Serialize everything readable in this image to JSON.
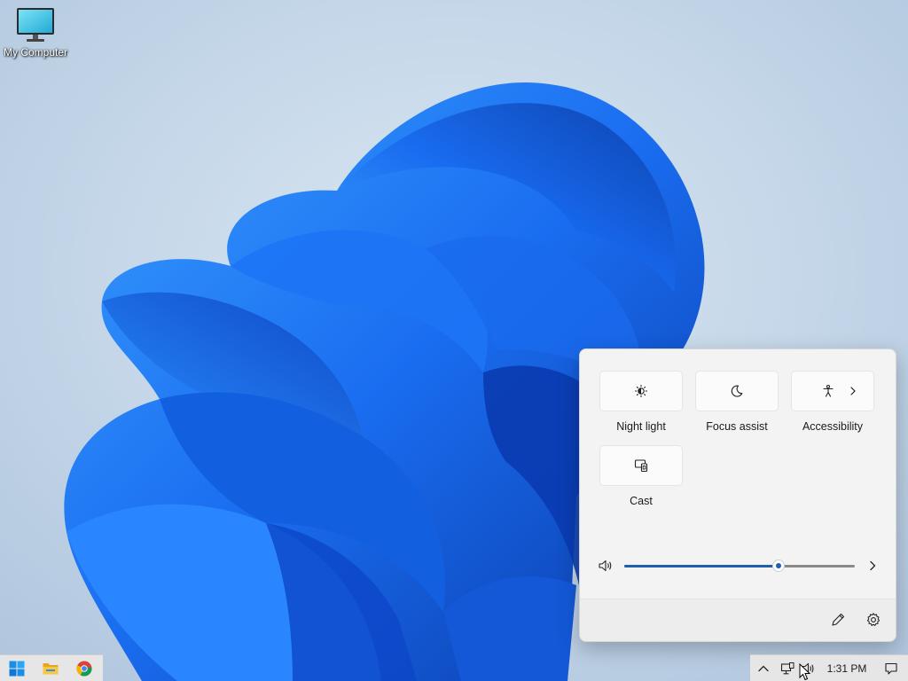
{
  "desktop": {
    "icons": [
      {
        "label": "My Computer",
        "icon": "computer-monitor-icon"
      }
    ]
  },
  "quick_settings": {
    "tiles": [
      {
        "label": "Night light",
        "icon": "night-light-icon",
        "has_chevron": false
      },
      {
        "label": "Focus assist",
        "icon": "moon-icon",
        "has_chevron": false
      },
      {
        "label": "Accessibility",
        "icon": "accessibility-icon",
        "has_chevron": true
      },
      {
        "label": "Cast",
        "icon": "cast-icon",
        "has_chevron": false
      }
    ],
    "volume": {
      "level": 0.67,
      "icon": "speaker-icon"
    },
    "footer": {
      "edit_icon": "pencil-icon",
      "settings_icon": "gear-icon"
    }
  },
  "taskbar": {
    "pinned": [
      {
        "name": "start",
        "icon": "windows-logo-icon"
      },
      {
        "name": "file-explorer",
        "icon": "folder-icon"
      },
      {
        "name": "chrome",
        "icon": "chrome-icon"
      }
    ],
    "tray": {
      "icons": [
        "chevron-up-icon",
        "network-icon",
        "volume-icon"
      ],
      "clock": "1:31 PM",
      "notification_icon": "notification-icon"
    }
  },
  "colors": {
    "accent": "#1f5fae",
    "wallpaper_bg": "#c4d6e8",
    "bloom": "#1565e8",
    "panel_bg": "#f3f3f3"
  }
}
